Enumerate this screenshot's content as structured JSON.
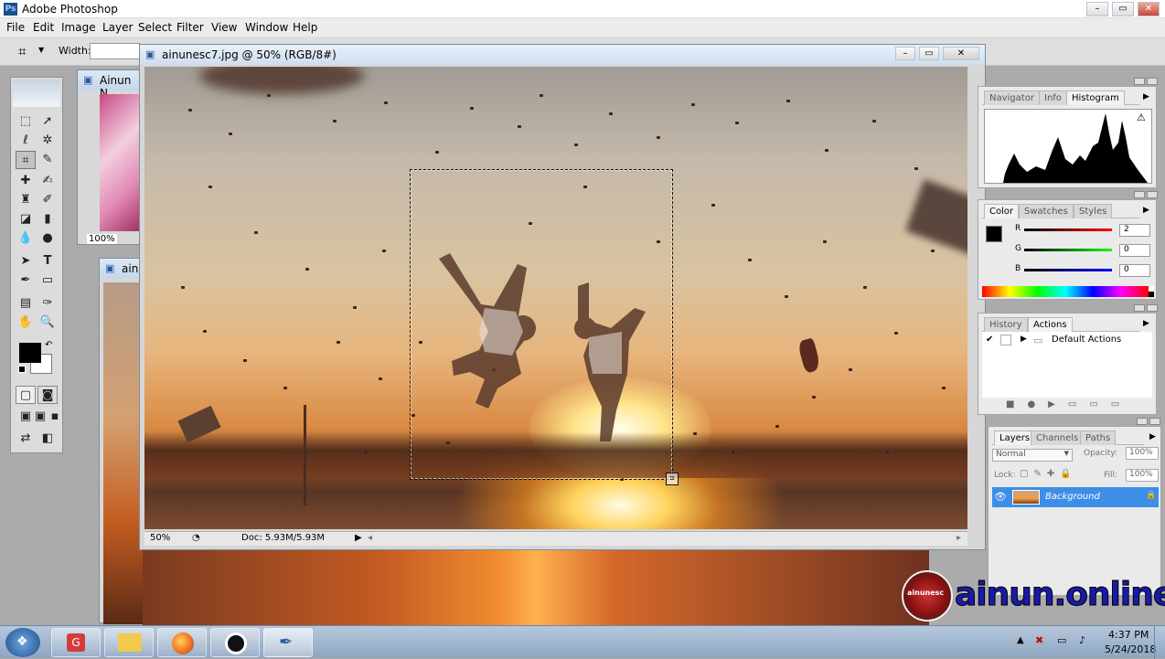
{
  "app": {
    "title": "Adobe Photoshop"
  },
  "menu": [
    "File",
    "Edit",
    "Image",
    "Layer",
    "Select",
    "Filter",
    "View",
    "Window",
    "Help"
  ],
  "options": {
    "width_label": "Width:"
  },
  "doc_back1": {
    "title": "Ainun N",
    "zoom": "100%"
  },
  "doc_back2": {
    "title": "ain"
  },
  "doc_main": {
    "title": "ainunesc7.jpg @ 50% (RGB/8#)",
    "zoom": "50%",
    "doc_info": "Doc: 5.93M/5.93M"
  },
  "navigator_panel": {
    "tabs": [
      "Navigator",
      "Info",
      "Histogram"
    ]
  },
  "color_panel": {
    "tabs": [
      "Color",
      "Swatches",
      "Styles"
    ],
    "r_label": "R",
    "g_label": "G",
    "b_label": "B",
    "r": "2",
    "g": "0",
    "b": "0"
  },
  "history_panel": {
    "tabs": [
      "History",
      "Actions"
    ],
    "action": "Default Actions"
  },
  "layers_panel": {
    "tabs": [
      "Layers",
      "Channels",
      "Paths"
    ],
    "blend": "Normal",
    "opacity_label": "Opacity:",
    "opacity": "100%",
    "lock_label": "Lock:",
    "fill_label": "Fill:",
    "fill": "100%",
    "layer_name": "Background"
  },
  "watermark": {
    "text": "ainun.online",
    "badge": "ainunesc"
  },
  "clock": {
    "time": "4:37 PM",
    "date": "5/24/2018"
  },
  "colors": {
    "selection_blue": "#3d8ee6",
    "fg": "#000000"
  }
}
